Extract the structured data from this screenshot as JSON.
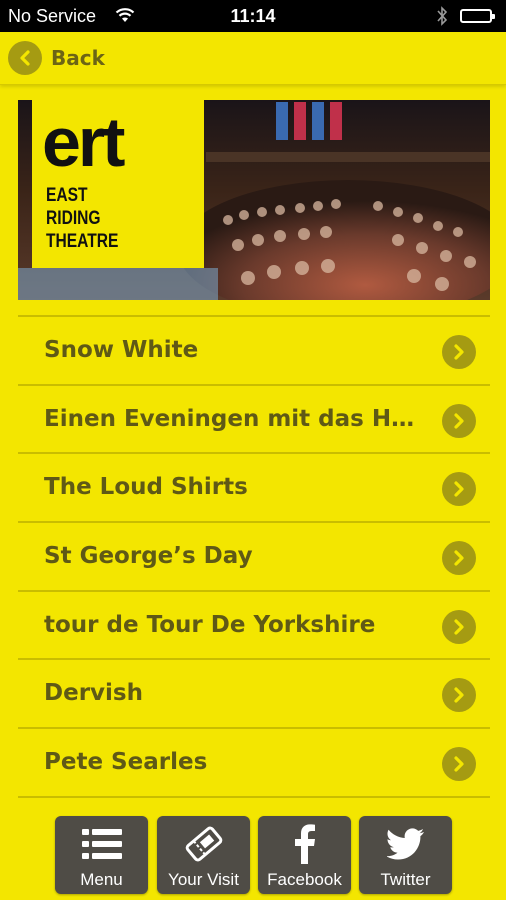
{
  "status_bar": {
    "carrier": "No Service",
    "time": "11:14",
    "wifi_icon": "wifi-icon",
    "bluetooth_icon": "bluetooth-icon",
    "battery_icon": "battery-icon"
  },
  "nav": {
    "back_label": "Back",
    "back_icon": "chevron-left-icon"
  },
  "banner": {
    "logo_mark": "ert",
    "logo_line1": "EAST",
    "logo_line2": "RIDING",
    "logo_line3": "THEATRE"
  },
  "events": [
    {
      "label": "Snow White"
    },
    {
      "label": "Einen Eveningen mit das He..."
    },
    {
      "label": "The Loud Shirts"
    },
    {
      "label": "St George’s Day"
    },
    {
      "label": "tour de Tour De Yorkshire"
    },
    {
      "label": "Dervish"
    },
    {
      "label": "Pete Searles"
    }
  ],
  "tabs": [
    {
      "label": "Menu",
      "icon": "list-icon"
    },
    {
      "label": "Your Visit",
      "icon": "ticket-icon"
    },
    {
      "label": "Facebook",
      "icon": "facebook-icon"
    },
    {
      "label": "Twitter",
      "icon": "twitter-icon"
    }
  ],
  "colors": {
    "background": "#f3e600",
    "accent": "#a59b12",
    "text": "#5f5916",
    "tab_background": "#4f4c46"
  }
}
